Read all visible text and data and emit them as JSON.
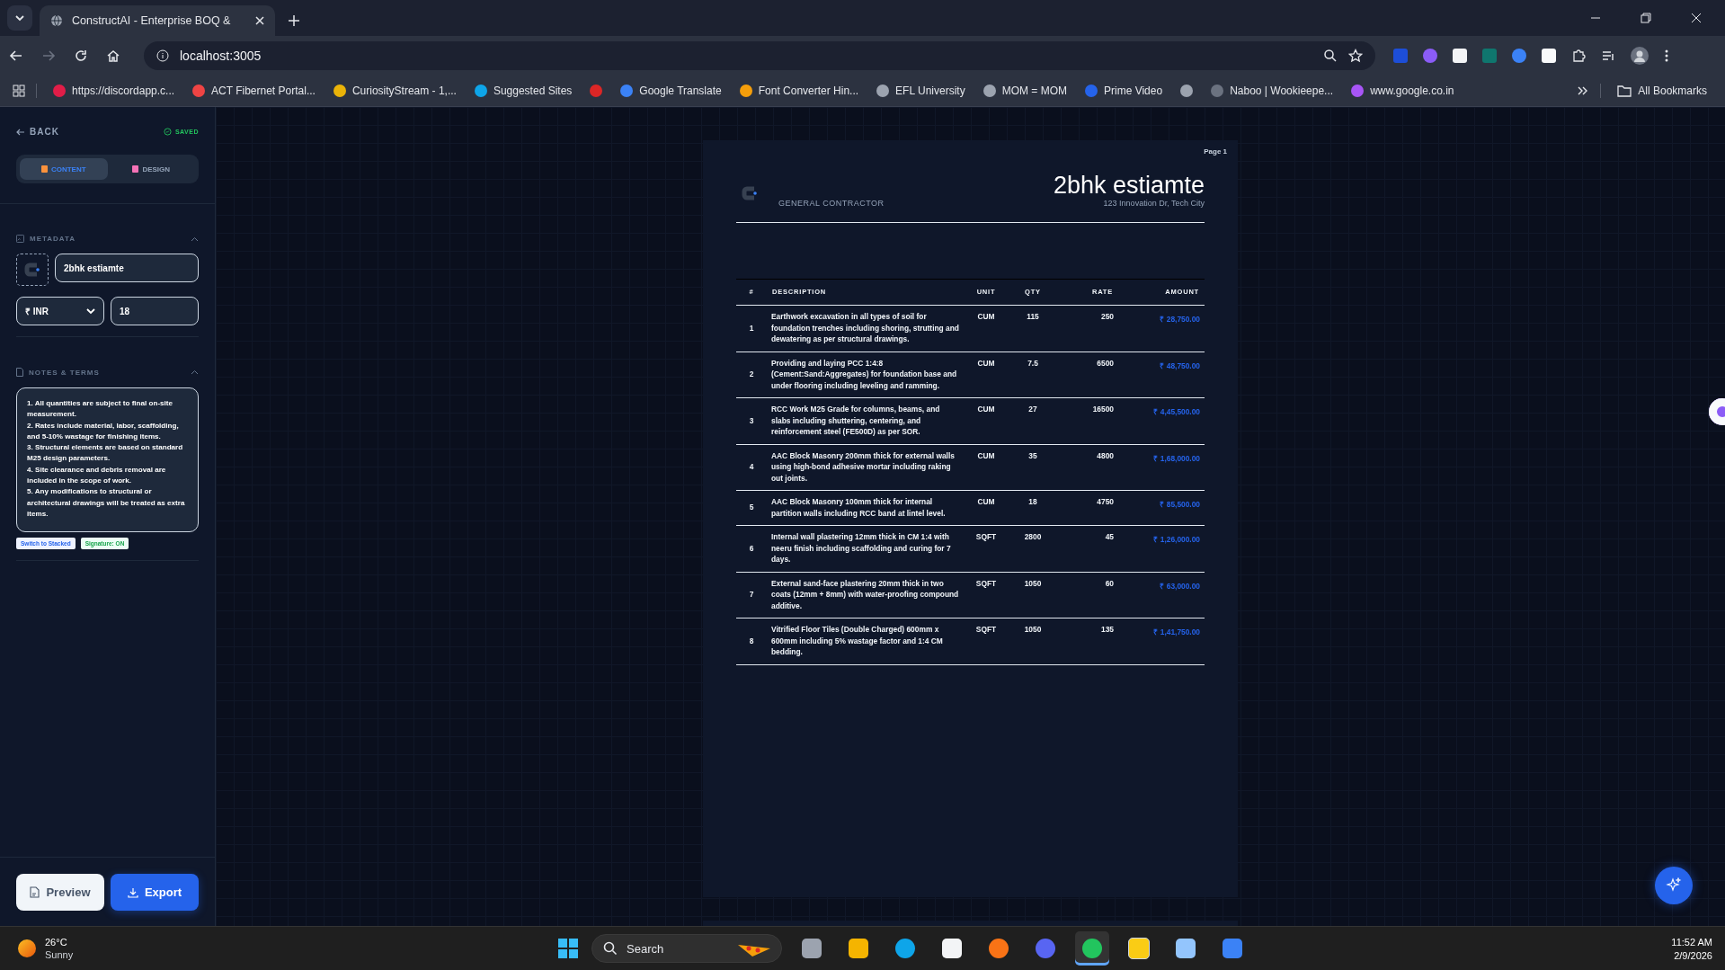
{
  "browser": {
    "tabs": [
      {
        "title": "ConstructAI - Enterprise BOQ &",
        "selected": true
      }
    ],
    "address": "localhost:3005",
    "bookmarks": [
      {
        "kind": "link",
        "label": "https://discordapp.c...",
        "color": "#e11d48"
      },
      {
        "kind": "link",
        "label": "ACT Fibernet Portal...",
        "color": "#ef4444"
      },
      {
        "kind": "link",
        "label": "CuriosityStream - 1,...",
        "color": "#eab308"
      },
      {
        "kind": "link",
        "label": "Suggested Sites",
        "color": "#0ea5e9"
      },
      {
        "kind": "icon",
        "color": "#dc2626"
      },
      {
        "kind": "link",
        "label": "Google Translate",
        "color": "#3b82f6"
      },
      {
        "kind": "link",
        "label": "Font Converter Hin...",
        "color": "#f59e0b"
      },
      {
        "kind": "link",
        "label": "EFL University",
        "color": "#9ca3af"
      },
      {
        "kind": "link",
        "label": "MOM = MOM",
        "color": "#9ca3af"
      },
      {
        "kind": "link",
        "label": "Prime Video",
        "color": "#2563eb"
      },
      {
        "kind": "icon",
        "color": "#9ca3af"
      },
      {
        "kind": "link",
        "label": "Naboo | Wookieepe...",
        "color": "#6b7280"
      },
      {
        "kind": "link",
        "label": "www.google.co.in",
        "color": "#a855f7"
      }
    ],
    "all_bookmarks": "All Bookmarks"
  },
  "sidebar": {
    "back": "BACK",
    "status": "SAVED",
    "mode_tabs": [
      {
        "label": "CONTENT",
        "selected": true
      },
      {
        "label": "DESIGN",
        "selected": false
      }
    ],
    "metadata": {
      "heading": "METADATA",
      "title": "2bhk estiamte",
      "currency": "₹ INR",
      "tax": "18"
    },
    "notes": {
      "heading": "NOTES & TERMS",
      "value": "1. All quantities are subject to final on-site measurement.\n2. Rates include material, labor, scaffolding, and 5-10% wastage for finishing items.\n3. Structural elements are based on standard M25 design parameters.\n4. Site clearance and debris removal are included in the scope of work.\n5. Any modifications to structural or architectural drawings will be treated as extra items."
    },
    "toggles": [
      {
        "label": "Switch to Stacked",
        "kind": "layout"
      },
      {
        "label": "Signature: ON",
        "kind": "signature"
      }
    ],
    "preview": "Preview",
    "export": "Export"
  },
  "document": {
    "page_label": "Page  1",
    "tagline": "GENERAL CONTRACTOR",
    "title": "2bhk estiamte",
    "address": "123 Innovation Dr, Tech City",
    "columns": [
      "#",
      "DESCRIPTION",
      "UNIT",
      "QTY",
      "RATE",
      "AMOUNT"
    ],
    "rows": [
      {
        "no": "1",
        "description": "Earthwork excavation in all types of soil for foundation trenches including shoring, strutting and dewatering as per structural drawings.",
        "unit": "CUM",
        "qty": "115",
        "rate": "250",
        "amount": "₹ 28,750.00"
      },
      {
        "no": "2",
        "description": "Providing and laying PCC 1:4:8 (Cement:Sand:Aggregates) for foundation base and under flooring including leveling and ramming.",
        "unit": "CUM",
        "qty": "7.5",
        "rate": "6500",
        "amount": "₹ 48,750.00"
      },
      {
        "no": "3",
        "description": "RCC Work M25 Grade for columns, beams, and slabs including shuttering, centering, and reinforcement steel (FE500D) as per SOR.",
        "unit": "CUM",
        "qty": "27",
        "rate": "16500",
        "amount": "₹ 4,45,500.00"
      },
      {
        "no": "4",
        "description": "AAC Block Masonry 200mm thick for external walls using high-bond adhesive mortar including raking out joints.",
        "unit": "CUM",
        "qty": "35",
        "rate": "4800",
        "amount": "₹ 1,68,000.00"
      },
      {
        "no": "5",
        "description": "AAC Block Masonry 100mm thick for internal partition walls including RCC band at lintel level.",
        "unit": "CUM",
        "qty": "18",
        "rate": "4750",
        "amount": "₹ 85,500.00"
      },
      {
        "no": "6",
        "description": "Internal wall plastering 12mm thick in CM 1:4 with neeru finish including scaffolding and curing for 7 days.",
        "unit": "SQFT",
        "qty": "2800",
        "rate": "45",
        "amount": "₹ 1,26,000.00"
      },
      {
        "no": "7",
        "description": "External sand-face plastering 20mm thick in two coats (12mm + 8mm) with water-proofing compound additive.",
        "unit": "SQFT",
        "qty": "1050",
        "rate": "60",
        "amount": "₹ 63,000.00"
      },
      {
        "no": "8",
        "description": "Vitrified Floor Tiles (Double Charged) 600mm x 600mm including 5% wastage factor and 1:4 CM bedding.",
        "unit": "SQFT",
        "qty": "1050",
        "rate": "135",
        "amount": "₹ 1,41,750.00"
      }
    ]
  },
  "taskbar": {
    "temperature": "26°C",
    "condition": "Sunny",
    "search": "Search",
    "time": "11:52 AM",
    "date": "2/9/2026",
    "apps": [
      {
        "kind": "files",
        "selected": false
      },
      {
        "kind": "folder",
        "selected": false
      },
      {
        "kind": "edge",
        "selected": false
      },
      {
        "kind": "store",
        "selected": false
      },
      {
        "kind": "firefox",
        "selected": false
      },
      {
        "kind": "discord",
        "selected": false
      },
      {
        "kind": "chrome",
        "selected": true
      },
      {
        "kind": "notes",
        "selected": false
      },
      {
        "kind": "monitor",
        "selected": false
      },
      {
        "kind": "arrow",
        "selected": false
      }
    ]
  }
}
